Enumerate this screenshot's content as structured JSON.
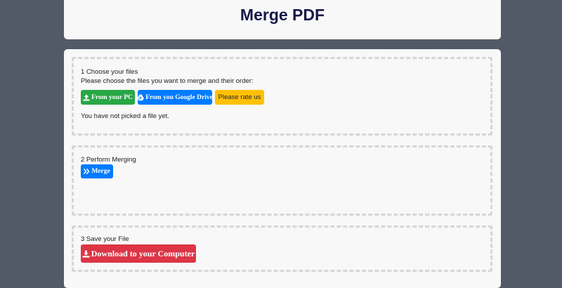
{
  "header": {
    "title": "Merge PDF"
  },
  "step1": {
    "title": "1 Choose your files",
    "description": "Please choose the files you want to merge and their order:",
    "from_pc_label": "From your PC",
    "from_drive_label": "From you Google Drive",
    "rate_label": "Please rate us",
    "status": "You have not picked a file yet."
  },
  "step2": {
    "title": "2 Perform Merging",
    "merge_label": "Merge"
  },
  "step3": {
    "title": "3 Save your File",
    "download_label": "Download to your Computer"
  },
  "colors": {
    "page_background": "#525a67",
    "card_background": "#f8f8f8",
    "title_color": "#191846",
    "green": "#28a745",
    "blue": "#007bff",
    "yellow": "#ffc107",
    "red": "#dc3545"
  },
  "icons": {
    "from_pc": "upload-icon",
    "from_drive": "google-drive-icon",
    "merge": "double-chevron-right-icon",
    "download": "download-icon"
  }
}
